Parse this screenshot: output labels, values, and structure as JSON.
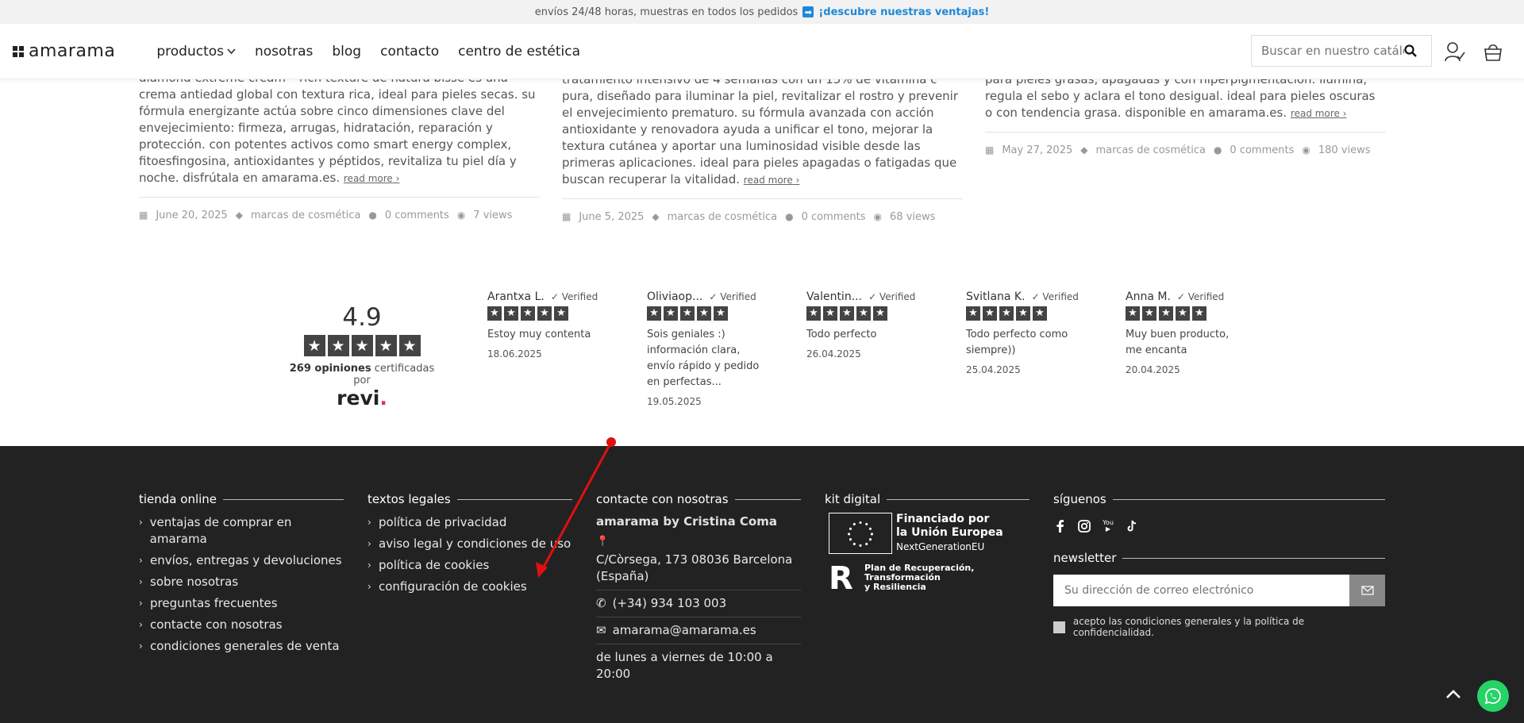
{
  "topbar": {
    "text": "envíos 24/48 horas, muestras en todos los pedidos",
    "arrow_glyph": "➡",
    "link": "¡descubre nuestras ventajas!"
  },
  "header": {
    "logo": "amarama",
    "nav": [
      {
        "label": "productos",
        "has_dropdown": true
      },
      {
        "label": "nosotras"
      },
      {
        "label": "blog"
      },
      {
        "label": "contacto"
      },
      {
        "label": "centro de estética"
      }
    ],
    "search_placeholder": "Buscar en nuestro catálogo"
  },
  "posts": [
    {
      "excerpt": "diamond extreme cream – rich texture de natura bissé es una crema antiedad global con textura rica, ideal para pieles secas. su fórmula energizante actúa sobre cinco dimensiones clave del envejecimiento: firmeza, arrugas, hidratación, reparación y protección. con potentes activos como smart energy complex, fitoesfingosina, antioxidantes y péptidos, revitaliza tu piel día y noche. disfrútala en amarama.es.",
      "read_more": "read more",
      "date": "June 20, 2025",
      "category": "marcas de cosmética",
      "comments": "0 comments",
      "views": "7 views"
    },
    {
      "excerpt": "tratamiento intensivo de 4 semanas con un 15% de vitamina c pura, diseñado para iluminar la piel, revitalizar el rostro y prevenir el envejecimiento prematuro. su fórmula avanzada con acción antioxidante y renovadora ayuda a unificar el tono, mejorar la textura cutánea y aportar una luminosidad visible desde las primeras aplicaciones. ideal para pieles apagadas o fatigadas que buscan recuperar la vitalidad.",
      "read_more": "read more",
      "date": "June 5, 2025",
      "category": "marcas de cosmética",
      "comments": "0 comments",
      "views": "68 views"
    },
    {
      "excerpt": "para pieles grasas, apagadas y con hiperpigmentación. ilumina, regula el sebo y aclara el tono desigual. ideal para pieles oscuras o con tendencia grasa. disponible en amarama.es.",
      "read_more": "read more",
      "date": "May 27, 2025",
      "category": "marcas de cosmética",
      "comments": "0 comments",
      "views": "180 views"
    }
  ],
  "rating": {
    "score": "4.9",
    "stars": 5,
    "count": "269 opiniones",
    "certified": "certificadas por",
    "provider": "revi",
    "provider_dot": "."
  },
  "reviews": [
    {
      "name": "Arantxa L.",
      "verified": "✓ Verified",
      "text": "Estoy muy contenta",
      "date": "18.06.2025"
    },
    {
      "name": "Oliviaop...",
      "verified": "✓ Verified",
      "text": "Sois geniales :) información clara, envío rápido y pedido en perfectas...",
      "date": "19.05.2025"
    },
    {
      "name": "Valentin...",
      "verified": "✓ Verified",
      "text": "Todo perfecto",
      "date": "26.04.2025"
    },
    {
      "name": "Svitlana K.",
      "verified": "✓ Verified",
      "text": "Todo perfecto como siempre))",
      "date": "25.04.2025"
    },
    {
      "name": "Anna M.",
      "verified": "✓ Verified",
      "text": "Muy buen producto, me encanta",
      "date": "20.04.2025"
    }
  ],
  "footer": {
    "tienda": {
      "title": "tienda online",
      "links": [
        "ventajas de comprar en amarama",
        "envíos, entregas y devoluciones",
        "sobre nosotras",
        "preguntas frecuentes",
        "contacte con nosotras",
        "condiciones generales de venta"
      ]
    },
    "legal": {
      "title": "textos legales",
      "links": [
        "política de privacidad",
        "aviso legal y condiciones de uso",
        "política de cookies",
        "configuración de cookies"
      ]
    },
    "contact": {
      "title": "contacte con nosotras",
      "brand": "amarama by Cristina Coma",
      "address": "C/Còrsega, 173 08036 Barcelona (España)",
      "phone": "(+34) 934 103 003",
      "email": "amarama@amarama.es",
      "hours": "de lunes a viernes de 10:00 a 20:00"
    },
    "kit": {
      "title": "kit digital",
      "eu_line1": "Financiado por",
      "eu_line2": "la Unión Europea",
      "eu_sub": "NextGenerationEU",
      "plan_line1": "Plan de Recuperación,",
      "plan_line2": "Transformación",
      "plan_line3": "y Resiliencia"
    },
    "social": {
      "title": "síguenos",
      "icons": [
        "facebook-icon",
        "instagram-icon",
        "youtube-icon",
        "tiktok-icon"
      ],
      "youtube_glyph": "▶"
    },
    "newsletter": {
      "title": "newsletter",
      "placeholder": "Su dirección de correo electrónico",
      "consent": "acepto las condiciones generales y la política de confidencialidad."
    }
  },
  "colors": {
    "accent": "#1e88d8",
    "footer_bg": "#222222",
    "whatsapp": "#25d366",
    "annotation": "#e01010"
  }
}
